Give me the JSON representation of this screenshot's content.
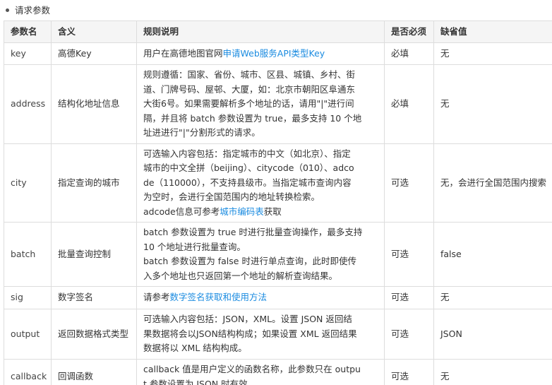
{
  "section": {
    "title": "请求参数"
  },
  "columns": [
    "参数名",
    "含义",
    "规则说明",
    "是否必须",
    "缺省值"
  ],
  "rows": [
    {
      "name": "key",
      "meaning": "高德Key",
      "desc_lines": [
        {
          "parts": [
            {
              "text": "用户在高德地图官网"
            },
            {
              "text": "申请Web服务API类型Key",
              "link": true
            }
          ]
        }
      ],
      "required": "必填",
      "default": "无"
    },
    {
      "name": "address",
      "meaning": "结构化地址信息",
      "desc_lines": [
        {
          "parts": [
            {
              "text": "规则遵循：国家、省份、城市、区县、城镇、乡村、街"
            }
          ]
        },
        {
          "parts": [
            {
              "text": "道、门牌号码、屋邨、大厦，如：北京市朝阳区阜通东"
            }
          ]
        },
        {
          "parts": [
            {
              "text": "大街6号。如果需要解析多个地址的话，请用\"|\"进行间"
            }
          ]
        },
        {
          "parts": [
            {
              "text": "隔，并且将 batch 参数设置为 true，最多支持 10 个地"
            }
          ]
        },
        {
          "parts": [
            {
              "text": "址进进行\"|\"分割形式的请求。"
            }
          ]
        }
      ],
      "required": "必填",
      "default": "无"
    },
    {
      "name": "city",
      "meaning": "指定查询的城市",
      "desc_lines": [
        {
          "parts": [
            {
              "text": "可选输入内容包括：指定城市的中文（如北京）、指定"
            }
          ]
        },
        {
          "parts": [
            {
              "text": "城市的中文全拼（beijing）、citycode（010）、adco"
            }
          ]
        },
        {
          "parts": [
            {
              "text": "de（110000），不支持县级市。当指定城市查询内容"
            }
          ]
        },
        {
          "parts": [
            {
              "text": "为空时，会进行全国范围内的地址转换检索。"
            }
          ]
        },
        {
          "parts": [
            {
              "text": "adcode信息可参考"
            },
            {
              "text": "城市编码表",
              "link": true
            },
            {
              "text": "获取"
            }
          ]
        }
      ],
      "required": "可选",
      "default": "无，会进行全国范围内搜索"
    },
    {
      "name": "batch",
      "meaning": "批量查询控制",
      "desc_lines": [
        {
          "parts": [
            {
              "text": "batch 参数设置为 true 时进行批量查询操作，最多支持"
            }
          ]
        },
        {
          "parts": [
            {
              "text": "10 个地址进行批量查询。"
            }
          ]
        },
        {
          "parts": [
            {
              "text": "batch 参数设置为 false 时进行单点查询，此时即使传"
            }
          ]
        },
        {
          "parts": [
            {
              "text": "入多个地址也只返回第一个地址的解析查询结果。"
            }
          ]
        }
      ],
      "required": "可选",
      "default": "false"
    },
    {
      "name": "sig",
      "meaning": "数字签名",
      "desc_lines": [
        {
          "parts": [
            {
              "text": "请参考"
            },
            {
              "text": "数字签名获取和使用方法",
              "link": true
            }
          ]
        }
      ],
      "required": "可选",
      "default": "无"
    },
    {
      "name": "output",
      "meaning": "返回数据格式类型",
      "desc_lines": [
        {
          "parts": [
            {
              "text": "可选输入内容包括：JSON，XML。设置 JSON 返回结"
            }
          ]
        },
        {
          "parts": [
            {
              "text": "果数据将会以JSON结构构成；如果设置 XML 返回结果"
            }
          ]
        },
        {
          "parts": [
            {
              "text": "数据将以 XML 结构构成。"
            }
          ]
        }
      ],
      "required": "可选",
      "default": "JSON"
    },
    {
      "name": "callback",
      "meaning": "回调函数",
      "desc_lines": [
        {
          "parts": [
            {
              "text": "callback 值是用户定义的函数名称，此参数只在 outpu"
            }
          ]
        },
        {
          "parts": [
            {
              "text": "t 参数设置为 JSON 时有效。"
            }
          ]
        }
      ],
      "required": "可选",
      "default": "无"
    }
  ],
  "colors": {
    "link": "#1a8be0",
    "header_bg": "#f5f5f5",
    "border": "#dddddd"
  }
}
